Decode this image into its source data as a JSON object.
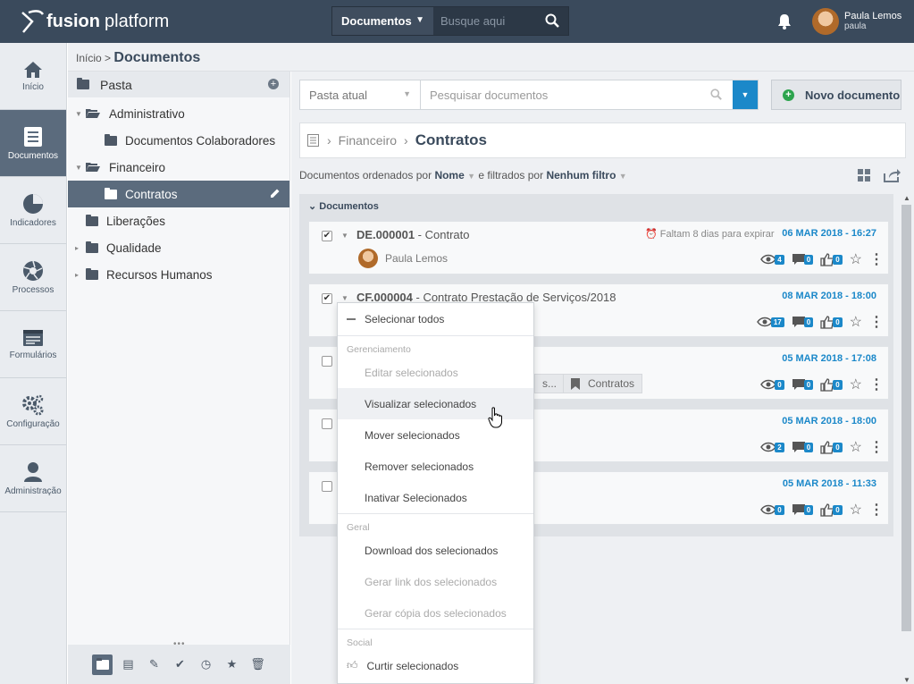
{
  "app": {
    "brand_bold": "fusion",
    "brand_light": "platform"
  },
  "topbar": {
    "search_select": "Documentos",
    "search_placeholder": "Busque aqui",
    "user_name": "Paula Lemos",
    "user_login": "paula"
  },
  "sidenav": [
    {
      "label": "Início",
      "icon": "home-icon"
    },
    {
      "label": "Documentos",
      "icon": "document-icon",
      "active": true
    },
    {
      "label": "Indicadores",
      "icon": "pie-chart-icon"
    },
    {
      "label": "Processos",
      "icon": "aperture-icon"
    },
    {
      "label": "Formulários",
      "icon": "form-icon"
    },
    {
      "label": "Configuração",
      "icon": "gears-icon"
    },
    {
      "label": "Administração",
      "icon": "user-icon"
    }
  ],
  "breadcrumb": {
    "home": "Início",
    "sep": ">",
    "current": "Documentos"
  },
  "tree": {
    "header": "Pasta",
    "items": [
      {
        "label": "Administrativo"
      },
      {
        "label": "Documentos Colaboradores"
      },
      {
        "label": "Financeiro"
      },
      {
        "label": "Contratos"
      },
      {
        "label": "Liberações"
      },
      {
        "label": "Qualidade"
      },
      {
        "label": "Recursos Humanos"
      }
    ]
  },
  "toolbar": {
    "scope": "Pasta atual",
    "search_placeholder": "Pesquisar documentos",
    "new_button": "Novo documento"
  },
  "path": {
    "parent": "Financeiro",
    "current": "Contratos"
  },
  "ordering": {
    "prefix": "Documentos ordenados por",
    "order": "Nome",
    "middle": "e filtrados por",
    "filter": "Nenhum filtro"
  },
  "panel": {
    "title": "Documentos"
  },
  "documents": [
    {
      "code": "DE.000001",
      "title": " - Contrato",
      "checked": true,
      "expire": "Faltam 8 dias para expirar",
      "date": "06 MAR 2018 - 16:27",
      "owner": "Paula Lemos",
      "views": "4",
      "comments": "0",
      "likes": "0"
    },
    {
      "code": "CF.000004",
      "title": " - Contrato Prestação de Serviços/2018",
      "checked": true,
      "date": "08 MAR 2018 - 18:00",
      "views": "17",
      "comments": "0",
      "likes": "0"
    },
    {
      "code": "",
      "title": "",
      "checked": false,
      "date": "05 MAR 2018 - 17:08",
      "tag_partial": "s...",
      "tag": "Contratos",
      "views": "0",
      "comments": "0",
      "likes": "0"
    },
    {
      "code": "",
      "title": "",
      "checked": false,
      "date": "05 MAR 2018 - 18:00",
      "views": "2",
      "comments": "0",
      "likes": "0"
    },
    {
      "code": "",
      "title": "",
      "checked": false,
      "date": "05 MAR 2018 - 11:33",
      "views": "0",
      "comments": "0",
      "likes": "0"
    }
  ],
  "menu": {
    "select_all": "Selecionar todos",
    "sec1": "Gerenciamento",
    "edit": "Editar selecionados",
    "view": "Visualizar selecionados",
    "move": "Mover selecionados",
    "remove": "Remover selecionados",
    "inactivate": "Inativar Selecionados",
    "sec2": "Geral",
    "download": "Download dos selecionados",
    "link": "Gerar link dos selecionados",
    "copy": "Gerar cópia dos selecionados",
    "sec3": "Social",
    "like": "Curtir selecionados"
  },
  "colors": {
    "topbar": "#3a4a5c",
    "accent": "#1b88c9",
    "active_nav": "#5b6b7d",
    "green": "#2da44e"
  }
}
